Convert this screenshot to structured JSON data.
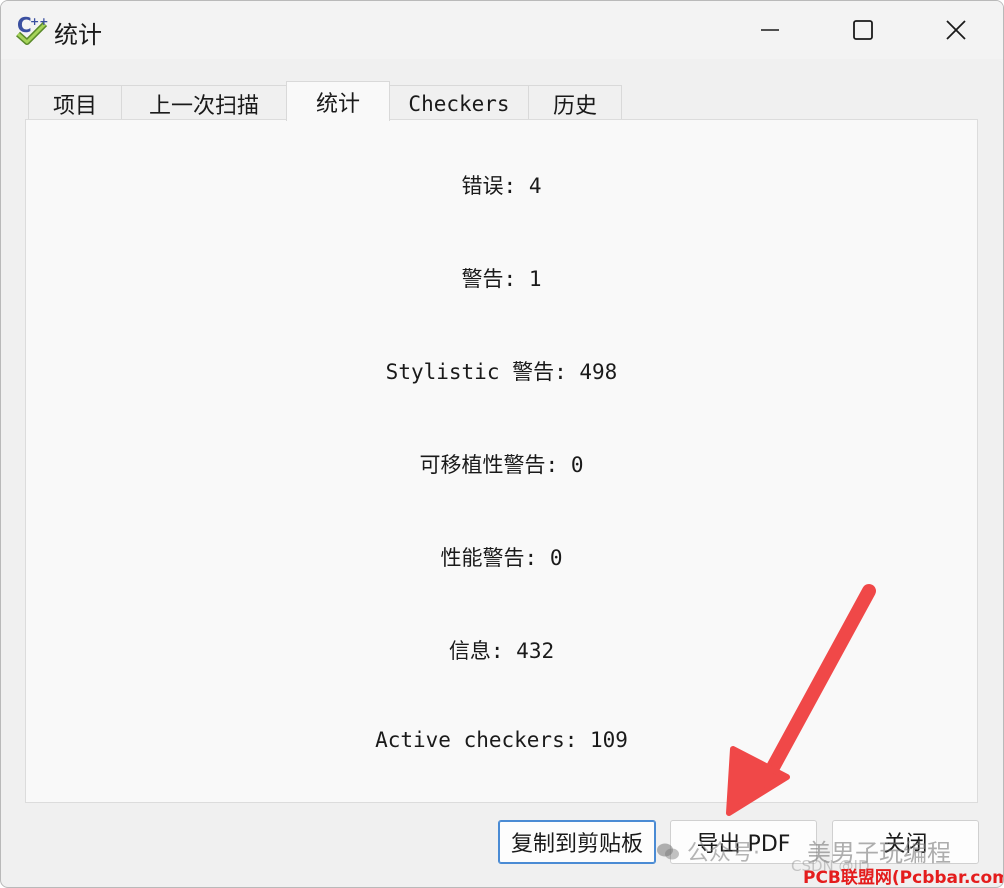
{
  "window": {
    "title": "统计"
  },
  "tabs": [
    {
      "label": "项目"
    },
    {
      "label": "上一次扫描"
    },
    {
      "label": "统计"
    },
    {
      "label": "Checkers"
    },
    {
      "label": "历史"
    }
  ],
  "stats": [
    {
      "text": "错误: 4"
    },
    {
      "text": "警告: 1"
    },
    {
      "text": "Stylistic 警告: 498"
    },
    {
      "text": "可移植性警告: 0"
    },
    {
      "text": "性能警告: 0"
    },
    {
      "text": "信息: 432"
    },
    {
      "text": "Active checkers: 109"
    }
  ],
  "buttons": {
    "copy": "复制到剪贴板",
    "export_pdf": "导出 PDF",
    "close": "关闭"
  },
  "watermarks": {
    "wechat": "公众号·",
    "author": "美男子玩编程",
    "csdn": "CSDN @ID",
    "site": "PCB联盟网(Pcbbar.com)"
  },
  "colors": {
    "arrow": "#f04848",
    "focus_border": "#4a8bd4",
    "site_watermark": "#e41d1d"
  },
  "icons": {
    "app": "cppcheck-icon",
    "minimize": "minimize-icon",
    "maximize": "maximize-icon",
    "close": "close-icon"
  }
}
